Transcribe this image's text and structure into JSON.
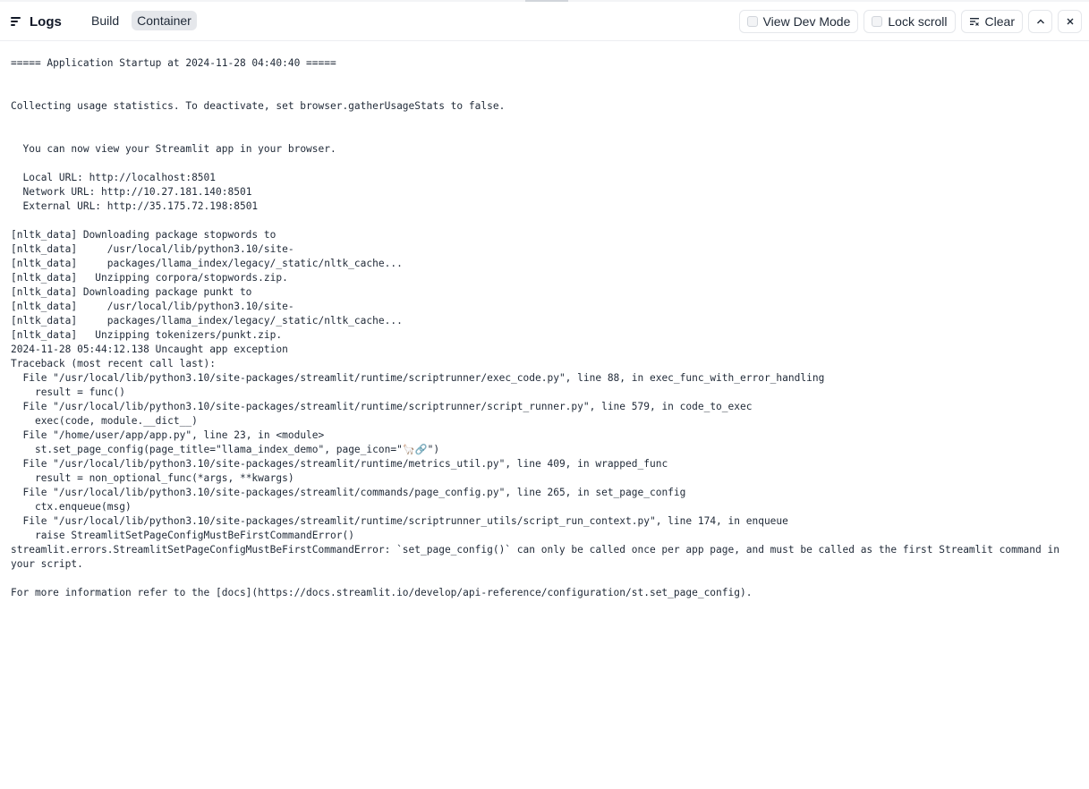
{
  "header": {
    "title": "Logs",
    "tabs": [
      {
        "label": "Build",
        "active": false
      },
      {
        "label": "Container",
        "active": true
      }
    ],
    "actions": {
      "view_dev_mode": "View Dev Mode",
      "lock_scroll": "Lock scroll",
      "clear": "Clear"
    },
    "icons": {
      "title": "logs-list-icon",
      "clear": "clear-list-icon",
      "collapse": "chevron-up-icon",
      "close": "close-icon"
    }
  },
  "log_lines": [
    "===== Application Startup at 2024-11-28 04:40:40 =====",
    "",
    "",
    "Collecting usage statistics. To deactivate, set browser.gatherUsageStats to false.",
    "",
    "",
    "  You can now view your Streamlit app in your browser.",
    "",
    "  Local URL: http://localhost:8501",
    "  Network URL: http://10.27.181.140:8501",
    "  External URL: http://35.175.72.198:8501",
    "",
    "[nltk_data] Downloading package stopwords to",
    "[nltk_data]     /usr/local/lib/python3.10/site-",
    "[nltk_data]     packages/llama_index/legacy/_static/nltk_cache...",
    "[nltk_data]   Unzipping corpora/stopwords.zip.",
    "[nltk_data] Downloading package punkt to",
    "[nltk_data]     /usr/local/lib/python3.10/site-",
    "[nltk_data]     packages/llama_index/legacy/_static/nltk_cache...",
    "[nltk_data]   Unzipping tokenizers/punkt.zip.",
    "2024-11-28 05:44:12.138 Uncaught app exception",
    "Traceback (most recent call last):",
    "  File \"/usr/local/lib/python3.10/site-packages/streamlit/runtime/scriptrunner/exec_code.py\", line 88, in exec_func_with_error_handling",
    "    result = func()",
    "  File \"/usr/local/lib/python3.10/site-packages/streamlit/runtime/scriptrunner/script_runner.py\", line 579, in code_to_exec",
    "    exec(code, module.__dict__)",
    "  File \"/home/user/app/app.py\", line 23, in <module>",
    "    st.set_page_config(page_title=\"llama_index_demo\", page_icon=\"🦙🔗\")",
    "  File \"/usr/local/lib/python3.10/site-packages/streamlit/runtime/metrics_util.py\", line 409, in wrapped_func",
    "    result = non_optional_func(*args, **kwargs)",
    "  File \"/usr/local/lib/python3.10/site-packages/streamlit/commands/page_config.py\", line 265, in set_page_config",
    "    ctx.enqueue(msg)",
    "  File \"/usr/local/lib/python3.10/site-packages/streamlit/runtime/scriptrunner_utils/script_run_context.py\", line 174, in enqueue",
    "    raise StreamlitSetPageConfigMustBeFirstCommandError()",
    "streamlit.errors.StreamlitSetPageConfigMustBeFirstCommandError: `set_page_config()` can only be called once per app page, and must be called as the first Streamlit command in your script.",
    "",
    "For more information refer to the [docs](https://docs.streamlit.io/develop/api-reference/configuration/st.set_page_config)."
  ]
}
